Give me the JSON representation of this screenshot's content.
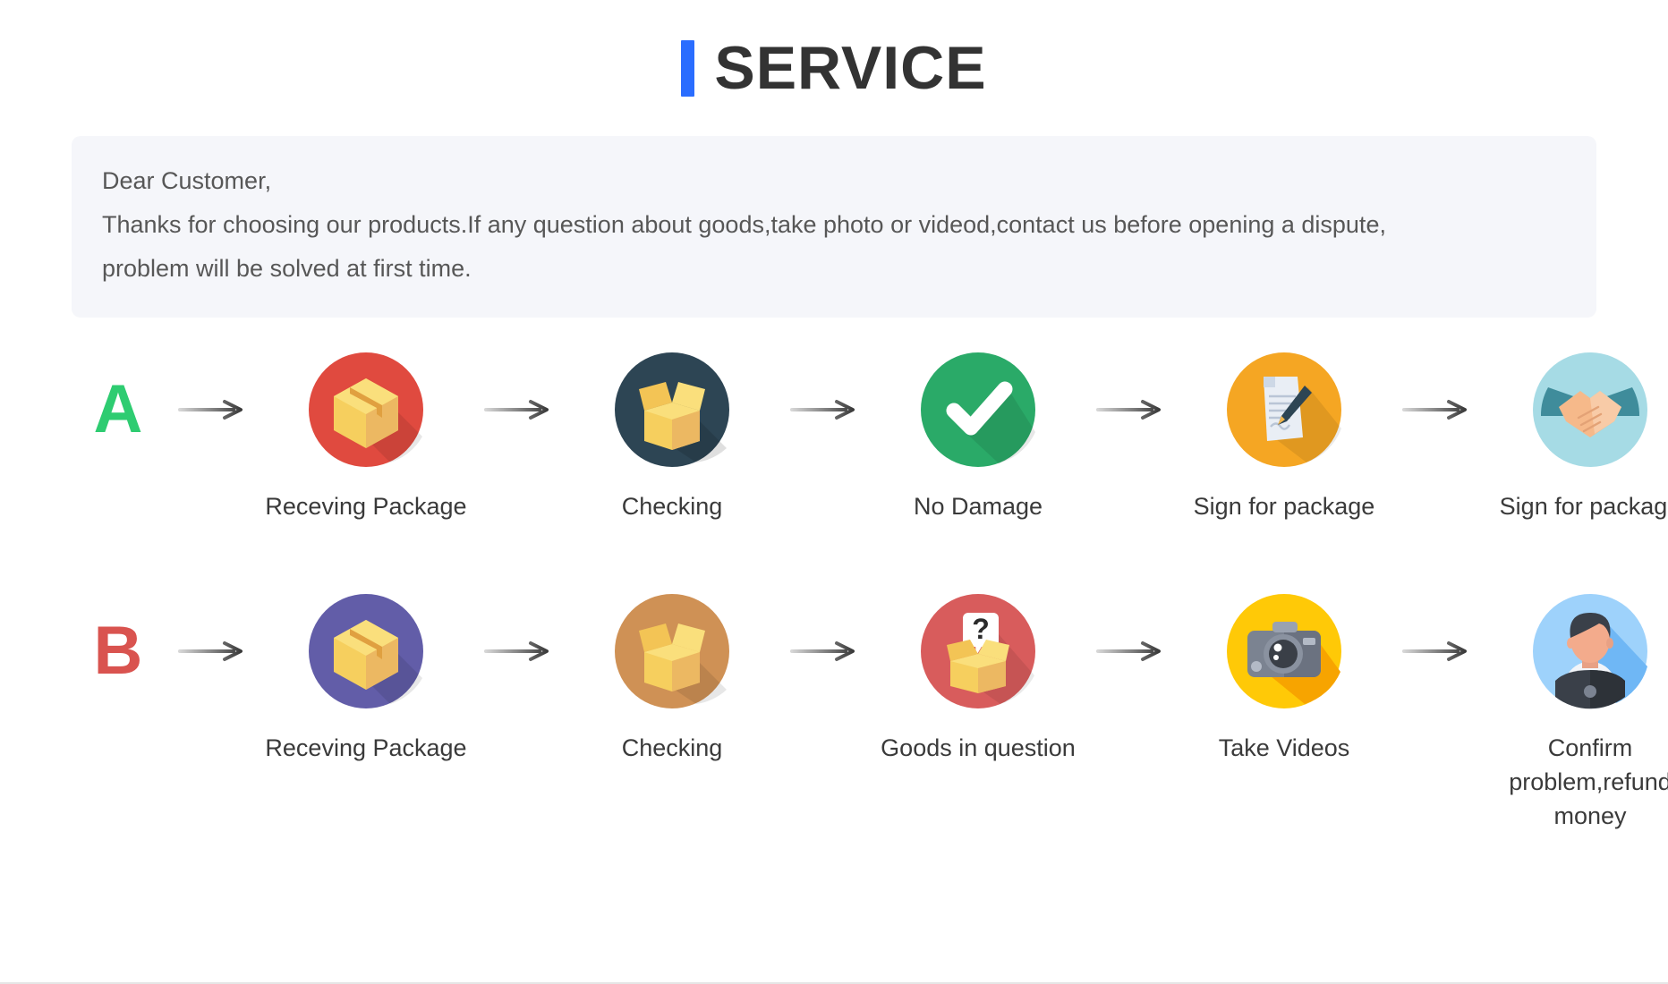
{
  "header": {
    "title": "SERVICE",
    "accent_color": "#2a6dff"
  },
  "notice": {
    "lines": [
      "Dear Customer,",
      "Thanks for choosing our products.If any question about goods,take photo or videod,contact us before opening a dispute,",
      "problem will be solved at first time."
    ],
    "background_color": "#f5f6fa",
    "text_color": "#575757"
  },
  "flows": [
    {
      "letter": "A",
      "letter_color": "#2ecc71",
      "steps": [
        {
          "label": "Receving Package",
          "icon": "closed-package-icon",
          "circle_color": "#e04a3f"
        },
        {
          "label": "Checking",
          "icon": "open-box-icon",
          "circle_color": "#2d4554"
        },
        {
          "label": "No Damage",
          "icon": "checkmark-icon",
          "circle_color": "#2aaa68"
        },
        {
          "label": "Sign for package",
          "icon": "document-pen-icon",
          "circle_color": "#f5a623"
        },
        {
          "label": "Sign for package",
          "icon": "handshake-icon",
          "circle_color": "#a6dbe5"
        }
      ]
    },
    {
      "letter": "B",
      "letter_color": "#d9534f",
      "steps": [
        {
          "label": "Receving Package",
          "icon": "closed-package-icon",
          "circle_color": "#625da8"
        },
        {
          "label": "Checking",
          "icon": "open-box-icon",
          "circle_color": "#cf9155"
        },
        {
          "label": "Goods in question",
          "icon": "question-box-icon",
          "circle_color": "#d85c5c"
        },
        {
          "label": "Take Videos",
          "icon": "camera-icon",
          "circle_color": "#ffc907"
        },
        {
          "label": "Confirm  problem,refund money",
          "icon": "support-agent-icon",
          "circle_color": "#9ed2fb"
        }
      ]
    }
  ]
}
